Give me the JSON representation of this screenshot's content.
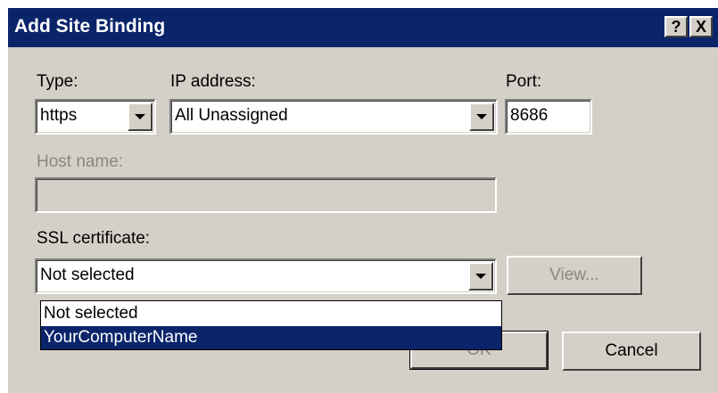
{
  "window": {
    "title": "Add Site Binding",
    "help_label": "?",
    "close_label": "X"
  },
  "type": {
    "label": "Type:",
    "value": "https"
  },
  "ip": {
    "label": "IP address:",
    "value": "All Unassigned"
  },
  "port": {
    "label": "Port:",
    "value": "8686"
  },
  "hostname": {
    "label": "Host name:",
    "value": ""
  },
  "ssl": {
    "label": "SSL certificate:",
    "value": "Not selected",
    "options": [
      "Not selected",
      "YourComputerName"
    ],
    "highlighted": "YourComputerName"
  },
  "buttons": {
    "view": "View...",
    "ok": "OK",
    "cancel": "Cancel"
  }
}
